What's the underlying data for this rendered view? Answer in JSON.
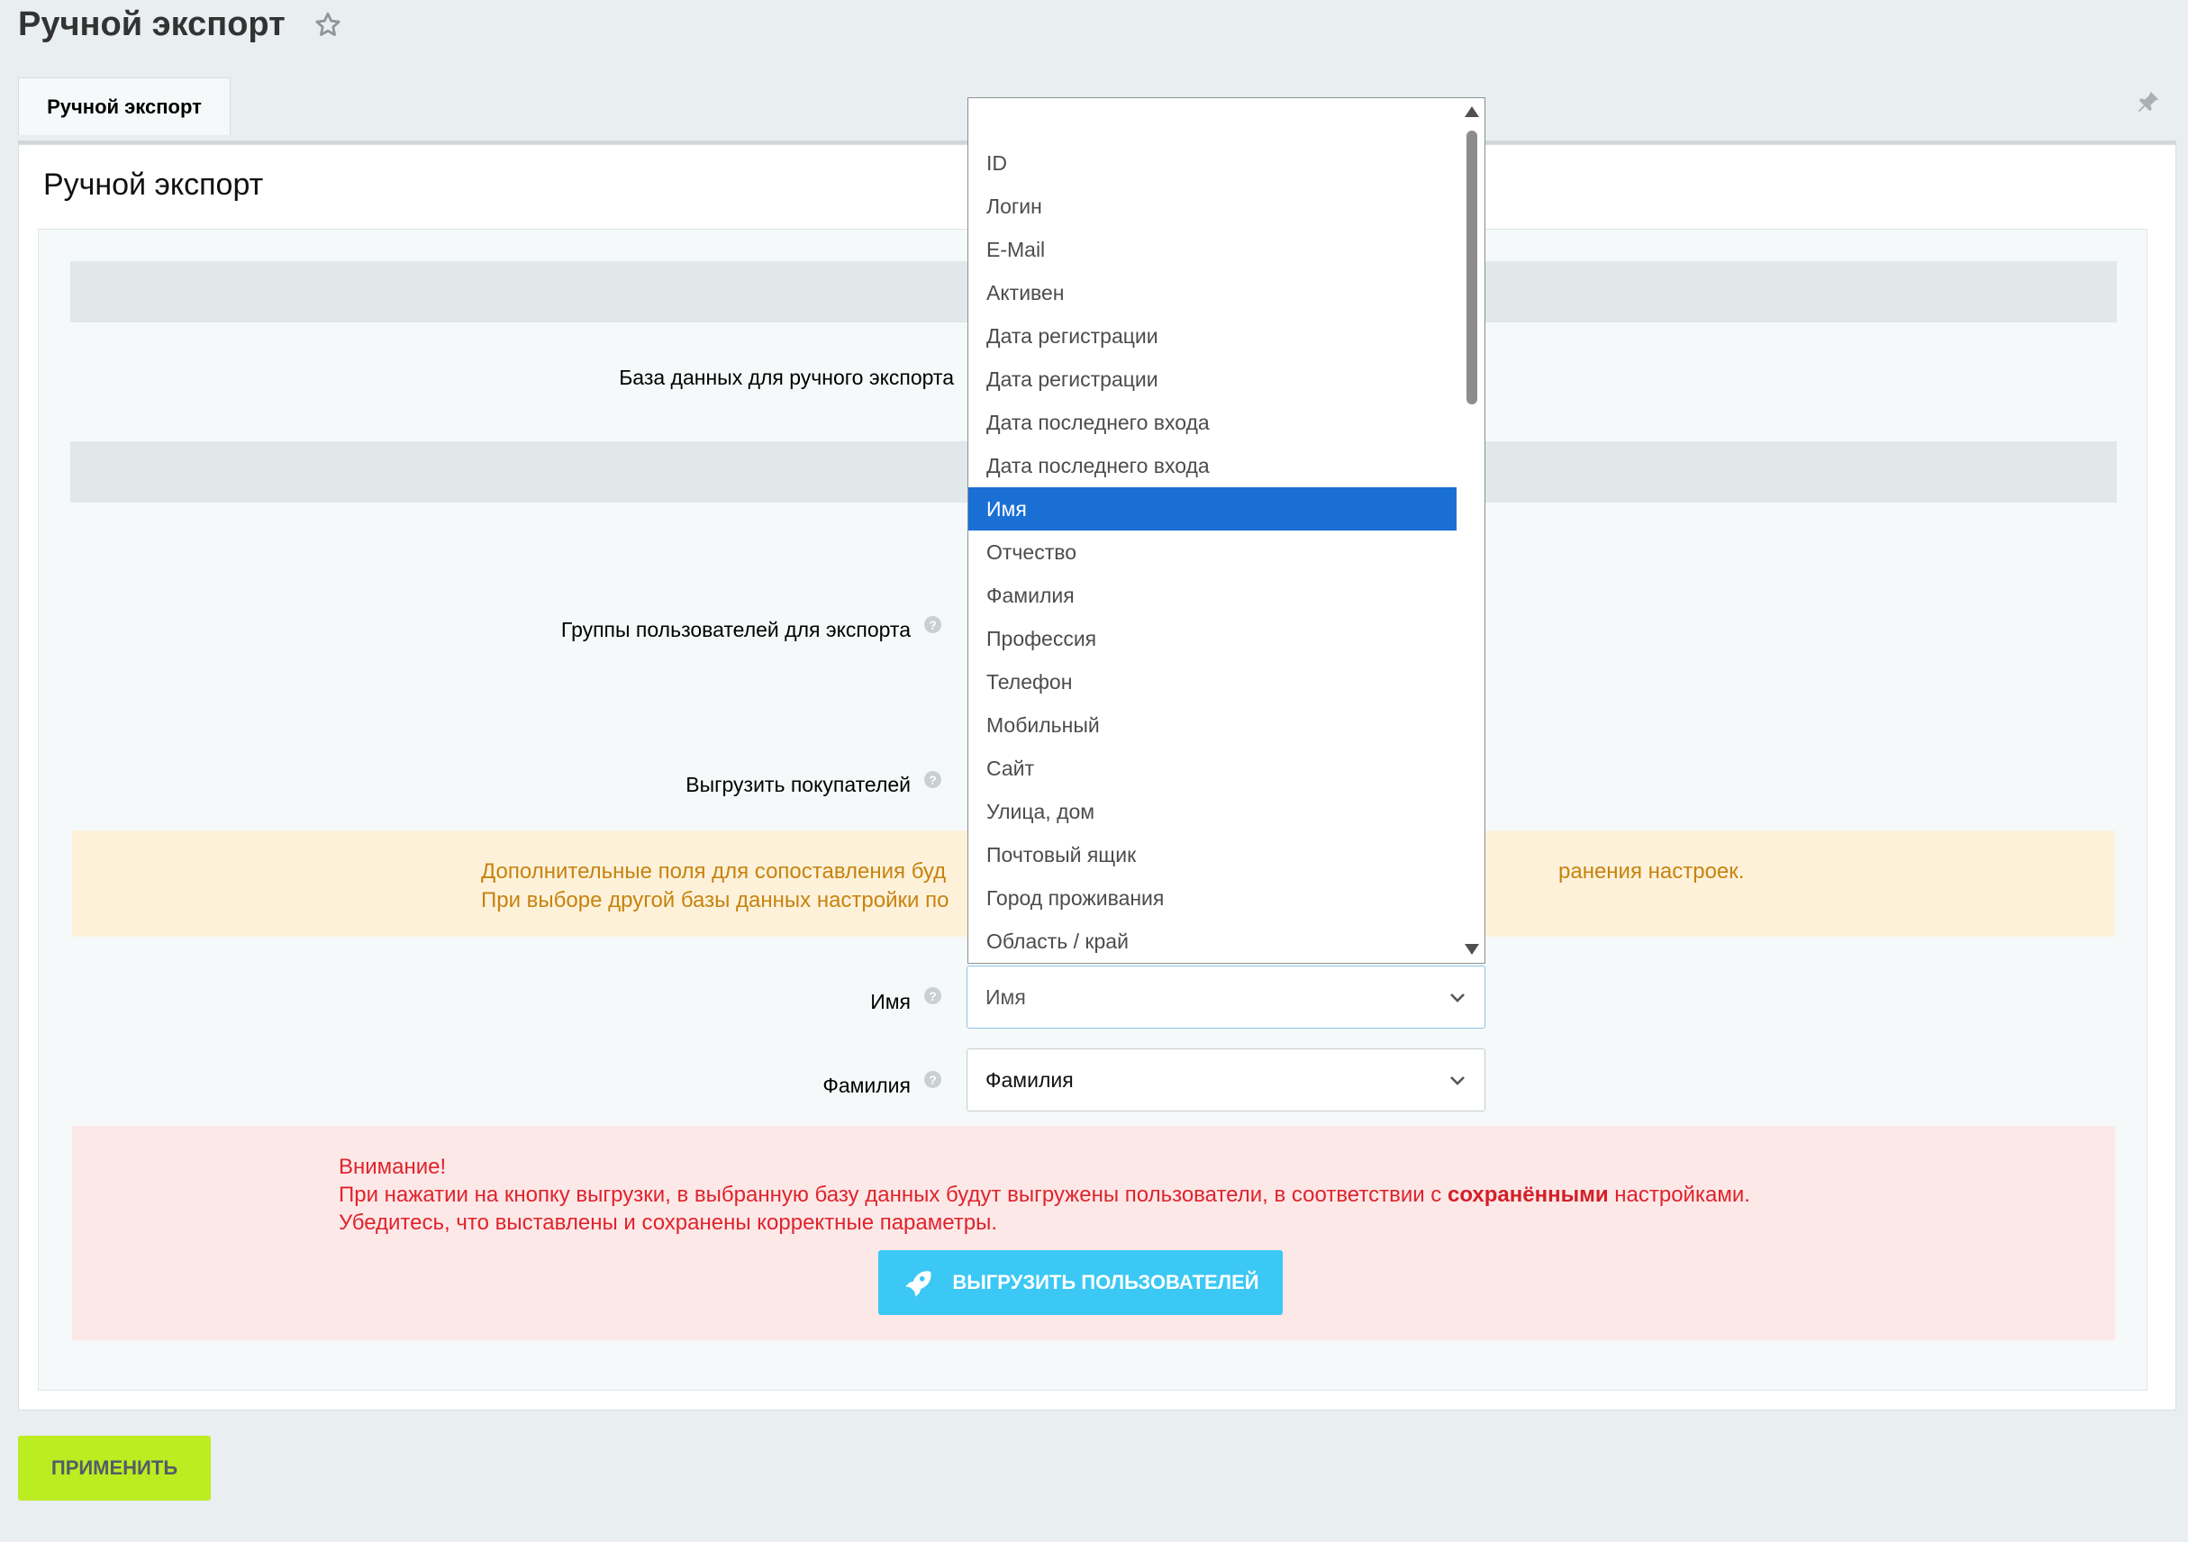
{
  "page": {
    "title": "Ручной экспорт"
  },
  "tabs": [
    {
      "label": "Ручной экспорт"
    }
  ],
  "section": {
    "title": "Ручной экспорт"
  },
  "fields": {
    "database": {
      "label": "База данных для ручного экспорта"
    },
    "groups": {
      "label": "Группы пользователей для экспорта"
    },
    "buyers": {
      "label": "Выгрузить покупателей"
    },
    "first_name": {
      "label": "Имя",
      "value": "Имя"
    },
    "last_name": {
      "label": "Фамилия",
      "value": "Фамилия"
    }
  },
  "warning": {
    "line1_start": "Дополнительные поля для сопоставления буд",
    "line1_end": "ранения настроек.",
    "line2": "При выборе другой базы данных настройки по"
  },
  "alert": {
    "title": "Внимание!",
    "line2_before": "При нажатии на кнопку выгрузки, в выбранную базу данных будут выгружены пользователи, в соответствии с ",
    "line2_bold": "сохранёнными",
    "line2_after": " настройками.",
    "line3": "Убедитесь, что выставлены и сохранены корректные параметры.",
    "button": "ВЫГРУЗИТЬ ПОЛЬЗОВАТЕЛЕЙ"
  },
  "apply_button": "ПРИМЕНИТЬ",
  "dropdown": {
    "options": [
      "ID",
      "Логин",
      "E-Mail",
      "Активен",
      "Дата регистрации",
      "Дата регистрации",
      "Дата последнего входа",
      "Дата последнего входа",
      "Имя",
      "Отчество",
      "Фамилия",
      "Профессия",
      "Телефон",
      "Мобильный",
      "Сайт",
      "Улица, дом",
      "Почтовый ящик",
      "Город проживания",
      "Область / край"
    ],
    "selected_index": 8
  },
  "colors": {
    "selected": "#1a6fd5",
    "export_button": "#3bc8f5",
    "apply_button": "#bbed21",
    "warning_text": "#c8820f",
    "alert_text": "#e0232b"
  }
}
